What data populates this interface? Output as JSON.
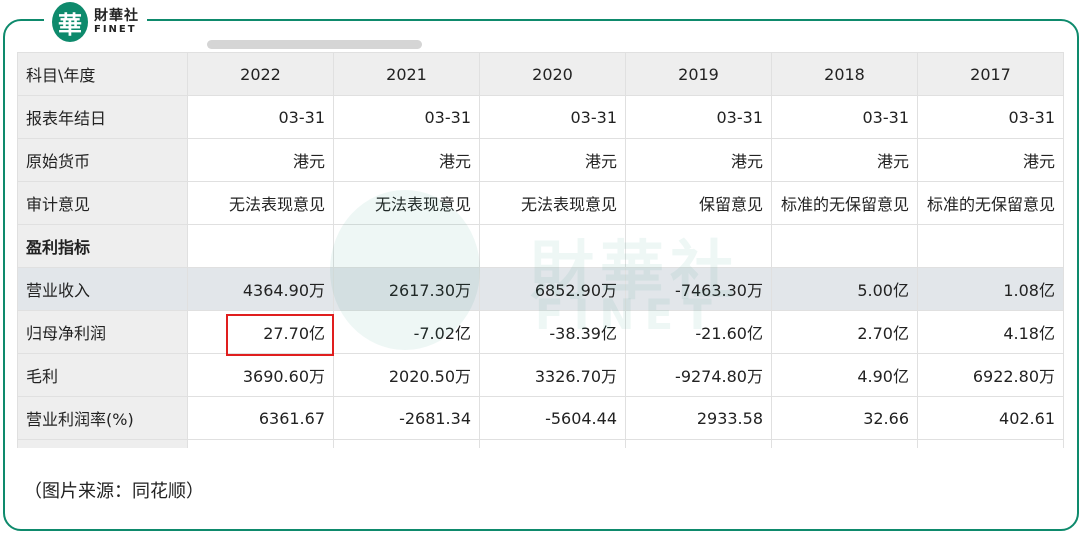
{
  "brand": {
    "badge": "華",
    "name_cn": "財華社",
    "name_en": "FINET"
  },
  "table": {
    "header": {
      "label": "科目\\年度",
      "years": [
        "2022",
        "2021",
        "2020",
        "2019",
        "2018",
        "2017"
      ]
    },
    "rows": [
      {
        "label": "报表年结日",
        "values": [
          "03-31",
          "03-31",
          "03-31",
          "03-31",
          "03-31",
          "03-31"
        ]
      },
      {
        "label": "原始货币",
        "values": [
          "港元",
          "港元",
          "港元",
          "港元",
          "港元",
          "港元"
        ]
      },
      {
        "label": "审计意见",
        "values": [
          "无法表现意见",
          "无法表现意见",
          "无法表现意见",
          "保留意见",
          "标准的无保留意见",
          "标准的无保留意见"
        ]
      },
      {
        "label": "盈利指标",
        "values": [
          "",
          "",
          "",
          "",
          "",
          ""
        ]
      },
      {
        "label": "营业收入",
        "values": [
          "4364.90万",
          "2617.30万",
          "6852.90万",
          "-7463.30万",
          "5.00亿",
          "1.08亿"
        ]
      },
      {
        "label": "归母净利润",
        "values": [
          "27.70亿",
          "-7.02亿",
          "-38.39亿",
          "-21.60亿",
          "2.70亿",
          "4.18亿"
        ]
      },
      {
        "label": "毛利",
        "values": [
          "3690.60万",
          "2020.50万",
          "3326.70万",
          "-9274.80万",
          "4.90亿",
          "6922.80万"
        ]
      },
      {
        "label": "营业利润率(%)",
        "values": [
          "6361.67",
          "-2681.34",
          "-5604.44",
          "2933.58",
          "32.66",
          "402.61"
        ]
      }
    ]
  },
  "watermark": {
    "cn": "財華社",
    "en": "FINET"
  },
  "caption": "（图片来源：同花顺）"
}
